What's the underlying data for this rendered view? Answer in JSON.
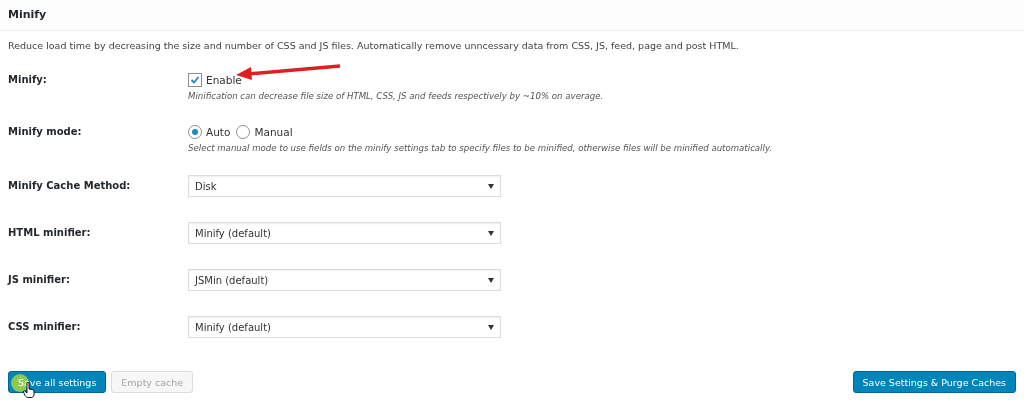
{
  "section_title": "Minify",
  "description": "Reduce load time by decreasing the size and number of CSS and JS files. Automatically remove unncessary data from CSS, JS, feed, page and post HTML.",
  "settings": [
    {
      "kind": "checkbox",
      "label": "Minify:",
      "option": "Enable",
      "checked": true,
      "annotated": true,
      "help": "Minification can decrease file size of HTML, CSS, JS and feeds respectively by ~10% on average."
    },
    {
      "kind": "radio",
      "label": "Minify mode:",
      "options": [
        {
          "label": "Auto",
          "selected": true
        },
        {
          "label": "Manual",
          "selected": false
        }
      ],
      "help": "Select manual mode to use fields on the minify settings tab to specify files to be minified, otherwise files will be minified automatically."
    },
    {
      "kind": "select",
      "label": "Minify Cache Method:",
      "value": "Disk"
    },
    {
      "kind": "select",
      "label": "HTML minifier:",
      "value": "Minify (default)"
    },
    {
      "kind": "select",
      "label": "JS minifier:",
      "value": "JSMin (default)"
    },
    {
      "kind": "select",
      "label": "CSS minifier:",
      "value": "Minify (default)"
    }
  ],
  "buttons": [
    {
      "label": "Save all settings",
      "kind": "primary",
      "disabled": false,
      "hovered": true
    },
    {
      "label": "Empty cache",
      "kind": "secondary",
      "disabled": true,
      "hovered": false
    }
  ],
  "right_button": {
    "label": "Save Settings & Purge Caches",
    "kind": "primary"
  }
}
